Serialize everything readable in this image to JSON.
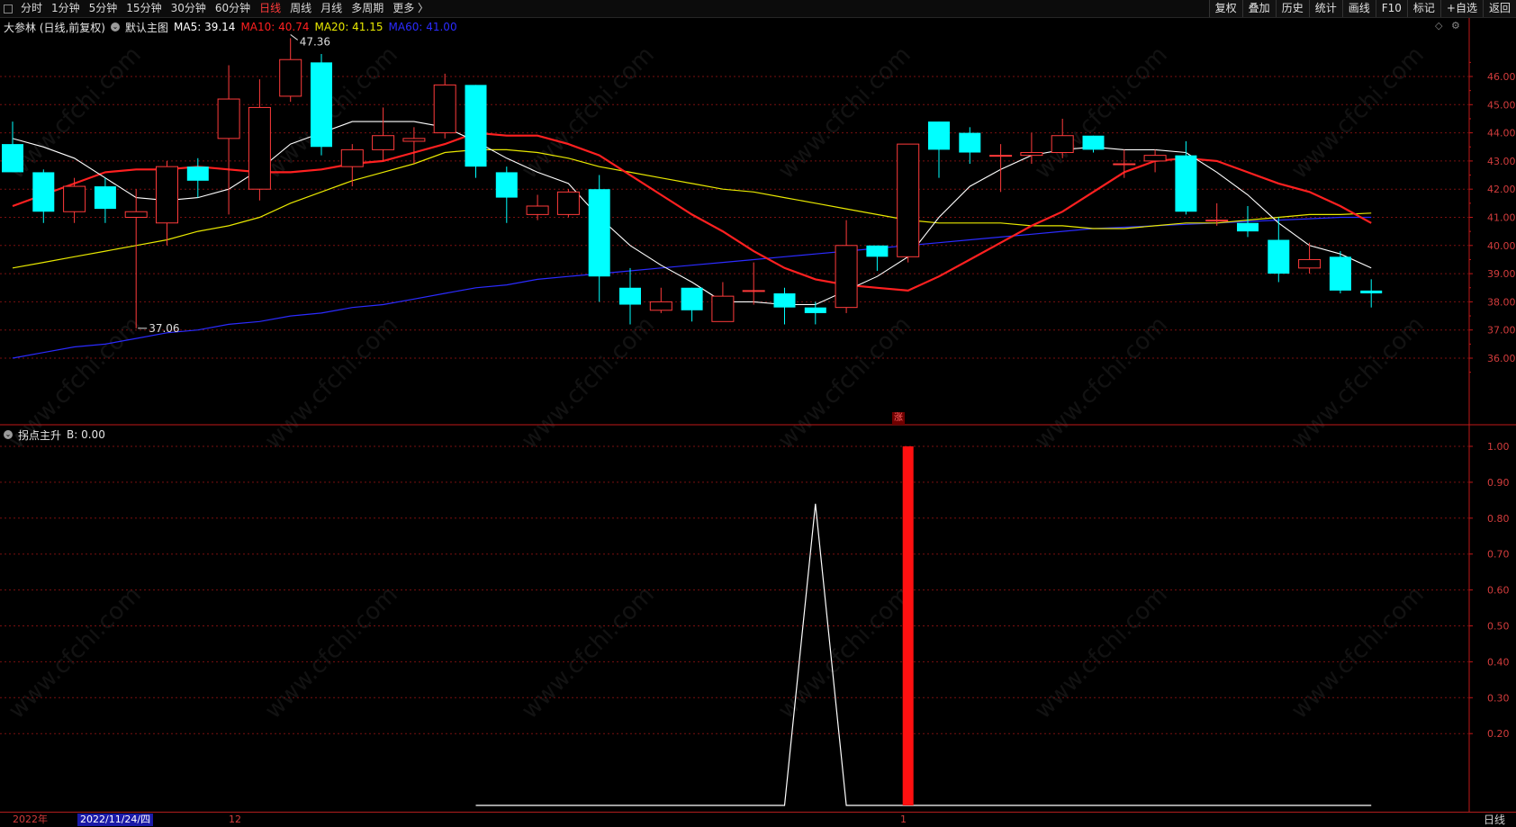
{
  "toolbar": {
    "periods": [
      "分时",
      "1分钟",
      "5分钟",
      "15分钟",
      "30分钟",
      "60分钟",
      "日线",
      "周线",
      "月线",
      "多周期",
      "更多 〉"
    ],
    "active_period": "日线",
    "tools": [
      "复权",
      "叠加",
      "历史",
      "统计",
      "画线",
      "F10",
      "标记",
      "+自选",
      "返回"
    ]
  },
  "main_info": {
    "stock": "大参林 (日线,前复权)",
    "chart_label": "默认主图",
    "ma5": "MA5: 39.14",
    "ma10": "MA10: 40.74",
    "ma20": "MA20: 41.15",
    "ma60": "MA60: 41.00"
  },
  "sub_info": {
    "indicator": "拐点主升",
    "value": "B: 0.00"
  },
  "annotations": {
    "high": "47.36",
    "low": "37.06",
    "zhang": "涨"
  },
  "price_axis": [
    "46.00",
    "45.00",
    "44.00",
    "43.00",
    "42.00",
    "41.00",
    "40.00",
    "39.00",
    "38.00",
    "37.00",
    "36.00"
  ],
  "indicator_axis": [
    "1.00",
    "0.90",
    "0.80",
    "0.70",
    "0.60",
    "0.50",
    "0.40",
    "0.30",
    "0.20"
  ],
  "date_axis": {
    "year": "2022年",
    "cursor": "2022/11/24/四",
    "month_12": "12",
    "month_1": "1",
    "period": "日线"
  },
  "watermark": "www.cfchi.com",
  "colors": {
    "up": "#ff3b3b",
    "down": "#00ffff",
    "ma5": "#ffffff",
    "ma10": "#ff2020",
    "ma20": "#e8e800",
    "ma60": "#2b2bff",
    "grid": "#7a1010"
  },
  "chart_data": [
    {
      "type": "candlestick",
      "title": "大参林 (日线,前复权)",
      "ylim": [
        35,
        47.5
      ],
      "candles": [
        {
          "o": 43.6,
          "h": 44.4,
          "l": 42.6,
          "c": 42.6
        },
        {
          "o": 42.6,
          "h": 42.7,
          "l": 40.8,
          "c": 41.2
        },
        {
          "o": 41.2,
          "h": 42.4,
          "l": 40.8,
          "c": 42.1
        },
        {
          "o": 42.1,
          "h": 42.4,
          "l": 40.8,
          "c": 41.3
        },
        {
          "o": 41.0,
          "h": 42.0,
          "l": 37.06,
          "c": 41.2
        },
        {
          "o": 40.8,
          "h": 43.0,
          "l": 40.0,
          "c": 42.8
        },
        {
          "o": 42.8,
          "h": 43.1,
          "l": 41.7,
          "c": 42.3
        },
        {
          "o": 43.8,
          "h": 46.4,
          "l": 41.1,
          "c": 45.2
        },
        {
          "o": 42.0,
          "h": 45.9,
          "l": 41.6,
          "c": 44.9
        },
        {
          "o": 45.3,
          "h": 47.36,
          "l": 45.1,
          "c": 46.6
        },
        {
          "o": 46.5,
          "h": 46.8,
          "l": 43.2,
          "c": 43.5
        },
        {
          "o": 42.8,
          "h": 43.6,
          "l": 42.1,
          "c": 43.4
        },
        {
          "o": 43.4,
          "h": 44.9,
          "l": 43.0,
          "c": 43.9
        },
        {
          "o": 43.7,
          "h": 44.2,
          "l": 42.9,
          "c": 43.8
        },
        {
          "o": 44.0,
          "h": 46.1,
          "l": 43.8,
          "c": 45.7
        },
        {
          "o": 45.7,
          "h": 45.7,
          "l": 42.4,
          "c": 42.8
        },
        {
          "o": 42.6,
          "h": 42.8,
          "l": 40.8,
          "c": 41.7
        },
        {
          "o": 41.1,
          "h": 41.8,
          "l": 40.9,
          "c": 41.4
        },
        {
          "o": 41.1,
          "h": 42.0,
          "l": 41.0,
          "c": 41.9
        },
        {
          "o": 42.0,
          "h": 42.5,
          "l": 38.0,
          "c": 38.9
        },
        {
          "o": 38.5,
          "h": 39.2,
          "l": 37.2,
          "c": 37.9
        },
        {
          "o": 37.7,
          "h": 38.5,
          "l": 37.6,
          "c": 38.0
        },
        {
          "o": 38.5,
          "h": 38.5,
          "l": 37.3,
          "c": 37.7
        },
        {
          "o": 37.3,
          "h": 38.7,
          "l": 37.3,
          "c": 38.2
        },
        {
          "o": 38.4,
          "h": 39.4,
          "l": 37.9,
          "c": 38.4
        },
        {
          "o": 38.3,
          "h": 38.5,
          "l": 37.2,
          "c": 37.8
        },
        {
          "o": 37.8,
          "h": 38.0,
          "l": 37.2,
          "c": 37.6
        },
        {
          "o": 37.8,
          "h": 40.9,
          "l": 37.6,
          "c": 40.0
        },
        {
          "o": 40.0,
          "h": 40.0,
          "l": 39.1,
          "c": 39.6
        },
        {
          "o": 39.6,
          "h": 43.6,
          "l": 39.4,
          "c": 43.6
        },
        {
          "o": 44.4,
          "h": 44.4,
          "l": 42.4,
          "c": 43.4
        },
        {
          "o": 44.0,
          "h": 44.2,
          "l": 42.9,
          "c": 43.3
        },
        {
          "o": 43.2,
          "h": 43.6,
          "l": 41.9,
          "c": 43.2
        },
        {
          "o": 43.2,
          "h": 44.0,
          "l": 42.9,
          "c": 43.3
        },
        {
          "o": 43.3,
          "h": 44.5,
          "l": 43.1,
          "c": 43.9
        },
        {
          "o": 43.9,
          "h": 43.9,
          "l": 43.3,
          "c": 43.4
        },
        {
          "o": 42.9,
          "h": 43.4,
          "l": 42.4,
          "c": 42.9
        },
        {
          "o": 43.0,
          "h": 43.4,
          "l": 42.6,
          "c": 43.2
        },
        {
          "o": 43.2,
          "h": 43.7,
          "l": 41.1,
          "c": 41.2
        },
        {
          "o": 40.9,
          "h": 41.5,
          "l": 40.7,
          "c": 40.9
        },
        {
          "o": 40.8,
          "h": 41.4,
          "l": 40.3,
          "c": 40.5
        },
        {
          "o": 40.2,
          "h": 41.0,
          "l": 38.7,
          "c": 39.0
        },
        {
          "o": 39.2,
          "h": 40.1,
          "l": 39.0,
          "c": 39.5
        },
        {
          "o": 39.6,
          "h": 39.8,
          "l": 38.3,
          "c": 38.4
        },
        {
          "o": 38.4,
          "h": 38.8,
          "l": 37.8,
          "c": 38.3
        }
      ],
      "ma5": [
        43.8,
        43.5,
        43.1,
        42.4,
        41.7,
        41.6,
        41.7,
        42.0,
        42.7,
        43.6,
        44.0,
        44.4,
        44.4,
        44.4,
        44.2,
        43.7,
        43.1,
        42.6,
        42.2,
        41.0,
        40.0,
        39.3,
        38.7,
        38.0,
        38.0,
        37.9,
        37.9,
        38.4,
        38.9,
        39.6,
        41.0,
        42.1,
        42.7,
        43.2,
        43.4,
        43.5,
        43.4,
        43.4,
        43.3,
        42.6,
        41.8,
        40.8,
        40.0,
        39.7,
        39.2
      ],
      "ma10": [
        41.4,
        41.8,
        42.2,
        42.6,
        42.7,
        42.7,
        42.8,
        42.7,
        42.6,
        42.6,
        42.7,
        42.9,
        43.0,
        43.3,
        43.6,
        44.0,
        43.9,
        43.9,
        43.6,
        43.2,
        42.5,
        41.8,
        41.1,
        40.5,
        39.8,
        39.2,
        38.8,
        38.6,
        38.5,
        38.4,
        38.9,
        39.5,
        40.1,
        40.7,
        41.2,
        41.9,
        42.6,
        43.0,
        43.1,
        43.0,
        42.6,
        42.2,
        41.9,
        41.4,
        40.8
      ],
      "ma20": [
        39.2,
        39.4,
        39.6,
        39.8,
        40.0,
        40.2,
        40.5,
        40.7,
        41.0,
        41.5,
        41.9,
        42.3,
        42.6,
        42.9,
        43.3,
        43.4,
        43.4,
        43.3,
        43.1,
        42.8,
        42.6,
        42.4,
        42.2,
        42.0,
        41.9,
        41.7,
        41.5,
        41.3,
        41.1,
        40.9,
        40.8,
        40.8,
        40.8,
        40.7,
        40.7,
        40.6,
        40.6,
        40.7,
        40.8,
        40.8,
        40.9,
        41.0,
        41.1,
        41.1,
        41.15
      ],
      "ma60": [
        36.0,
        36.2,
        36.4,
        36.5,
        36.7,
        36.9,
        37.0,
        37.2,
        37.3,
        37.5,
        37.6,
        37.8,
        37.9,
        38.1,
        38.3,
        38.5,
        38.6,
        38.8,
        38.9,
        39.0,
        39.1,
        39.2,
        39.3,
        39.4,
        39.5,
        39.6,
        39.7,
        39.8,
        39.9,
        40.0,
        40.1,
        40.2,
        40.3,
        40.4,
        40.5,
        40.6,
        40.65,
        40.7,
        40.75,
        40.8,
        40.85,
        40.9,
        40.95,
        41.0,
        41.0
      ]
    },
    {
      "type": "line",
      "title": "拐点主升",
      "ylim": [
        0,
        1.1
      ],
      "start_index": 15,
      "line_values": [
        0,
        0,
        0,
        0,
        0,
        0,
        0,
        0,
        0,
        0,
        0,
        0,
        0,
        0,
        0,
        0,
        0,
        0,
        0,
        0,
        0,
        0,
        0,
        0,
        0,
        0,
        0.84,
        0,
        0,
        0,
        0,
        0,
        0,
        0,
        0,
        0,
        0,
        0,
        0,
        0,
        0,
        0,
        0,
        0,
        0
      ],
      "bar_index": 29,
      "bar_value": 1.0
    }
  ]
}
